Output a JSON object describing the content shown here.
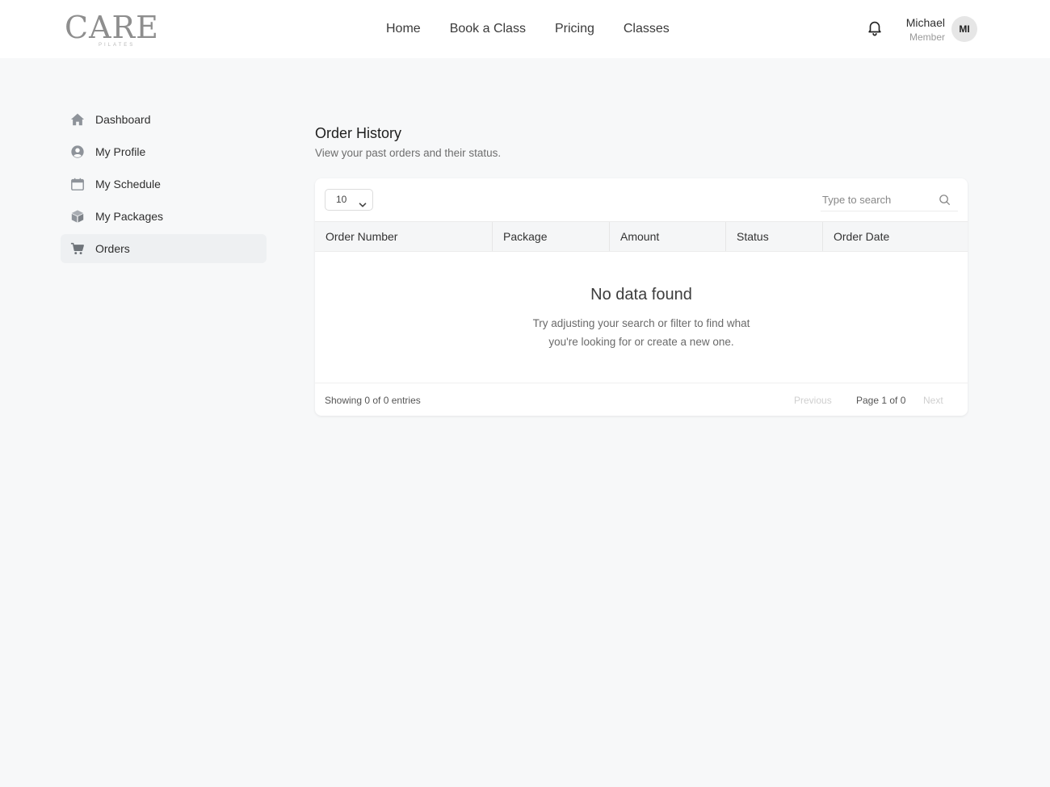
{
  "brand": {
    "logo_text": "CARE",
    "logo_subtext": "PILATES"
  },
  "nav": {
    "items": [
      {
        "label": "Home"
      },
      {
        "label": "Book a Class"
      },
      {
        "label": "Pricing"
      },
      {
        "label": "Classes"
      }
    ]
  },
  "user": {
    "name": "Michael",
    "role": "Member",
    "initials": "MI"
  },
  "icons": {
    "notifications": "bell-icon",
    "search": "search-icon"
  },
  "sidebar": {
    "items": [
      {
        "label": "Dashboard",
        "icon": "home-icon",
        "active": false
      },
      {
        "label": "My Profile",
        "icon": "user-circle-icon",
        "active": false
      },
      {
        "label": "My Schedule",
        "icon": "calendar-icon",
        "active": false
      },
      {
        "label": "My Packages",
        "icon": "package-icon",
        "active": false
      },
      {
        "label": "Orders",
        "icon": "cart-icon",
        "active": true
      }
    ]
  },
  "page": {
    "title": "Order History",
    "subtitle": "View your past orders and their status."
  },
  "table": {
    "page_size": "10",
    "search_placeholder": "Type to search",
    "columns": [
      "Order Number",
      "Package",
      "Amount",
      "Status",
      "Order Date"
    ],
    "rows": [],
    "empty_title": "No data found",
    "empty_message": "Try adjusting your search or filter to find what you're looking for or create a new one.",
    "showing": "Showing 0 of 0 entries",
    "prev_label": "Previous",
    "page_info": "Page 1 of 0",
    "next_label": "Next"
  },
  "colors": {
    "page_bg": "#f7f8f9",
    "active_item_bg": "#eef0f2",
    "icon_gray": "#8e939a",
    "disabled_text": "#cfcfcf"
  }
}
